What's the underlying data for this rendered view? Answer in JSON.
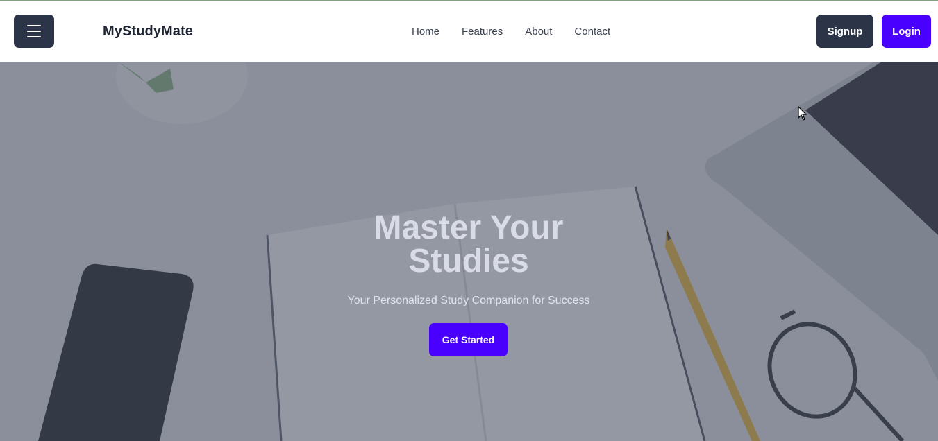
{
  "brand": {
    "name": "MyStudyMate"
  },
  "nav": {
    "items": [
      "Home",
      "Features",
      "About",
      "Contact"
    ]
  },
  "auth": {
    "signup_label": "Signup",
    "login_label": "Login"
  },
  "hero": {
    "title": "Master Your Studies",
    "subtitle": "Your Personalized Study Companion for Success",
    "cta_label": "Get Started"
  },
  "icons": {
    "menu": "hamburger-menu-icon",
    "cursor": "mouse-pointer-icon"
  },
  "colors": {
    "primary": "#4a00ff",
    "dark": "#2c3547",
    "brand_text": "#1e2533",
    "nav_text": "#3b4250"
  }
}
